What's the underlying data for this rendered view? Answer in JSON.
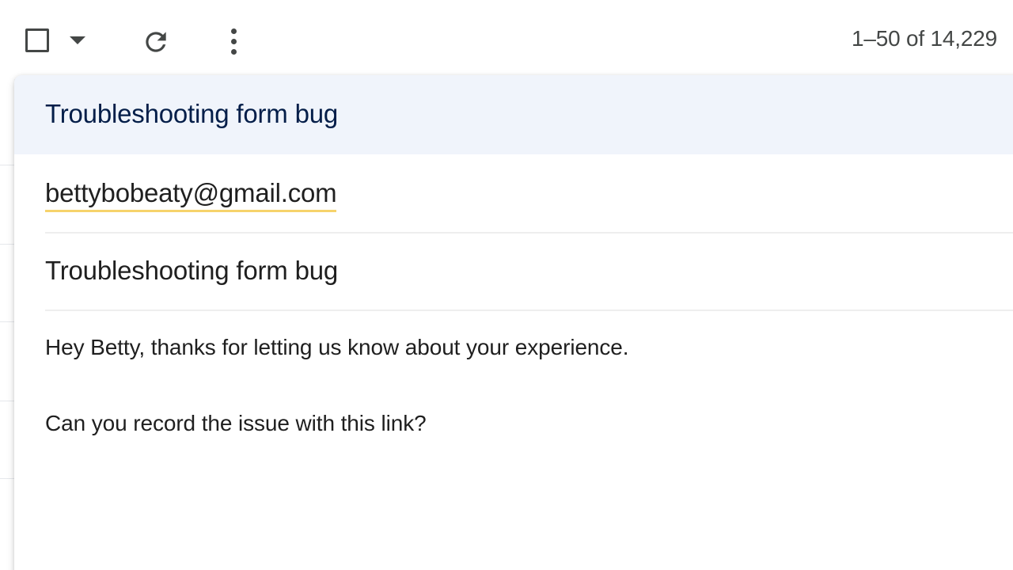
{
  "toolbar": {
    "icons": {
      "select_all": "checkbox-icon",
      "select_menu": "caret-down-icon",
      "refresh": "refresh-icon",
      "more": "more-vert-icon"
    },
    "pagination": "1–50 of 14,229"
  },
  "compose": {
    "title": "Troubleshooting form bug",
    "to": {
      "recipient": "bettybobeaty@gmail.com"
    },
    "subject": {
      "value": "Troubleshooting form bug"
    },
    "body": {
      "lines": [
        "Hey Betty, thanks for letting us know about your experience.",
        "Can you record the issue with this link?"
      ]
    }
  },
  "colors": {
    "header_bg": "#f0f4fb",
    "title_text": "#041e49",
    "recipient_underline": "#f6d36b",
    "icon": "#444746"
  }
}
